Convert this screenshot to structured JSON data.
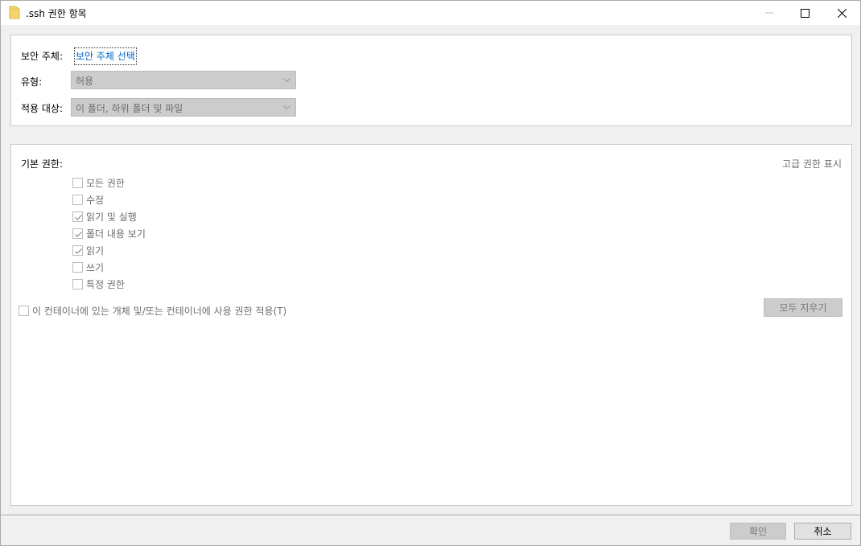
{
  "window": {
    "title": ".ssh 권한 항목"
  },
  "principal": {
    "label": "보안 주체:",
    "link": "보안 주체 선택"
  },
  "type": {
    "label": "유형:",
    "value": "허용"
  },
  "applies_to": {
    "label": "적용 대상:",
    "value": "이 폴더, 하위 폴더 및 파일"
  },
  "basic_permissions": {
    "label": "기본 권한:",
    "advanced_link": "고급 권한 표시",
    "items": [
      {
        "label": "모든 권한",
        "checked": false
      },
      {
        "label": "수정",
        "checked": false
      },
      {
        "label": "읽기 및 실행",
        "checked": true
      },
      {
        "label": "폴더 내용 보기",
        "checked": true
      },
      {
        "label": "읽기",
        "checked": true
      },
      {
        "label": "쓰기",
        "checked": false
      },
      {
        "label": "특정 권한",
        "checked": false
      }
    ],
    "apply_to_container": {
      "label": "이 컨테이너에 있는 개체 및/또는 컨테이너에 사용 권한 적용(T)",
      "checked": false
    },
    "clear_all_button": "모두 지우기"
  },
  "footer": {
    "ok_button": "확인",
    "cancel_button": "취소"
  },
  "colors": {
    "link": "#0066cc",
    "disabled_text": "#6d6d6d",
    "disabled_fill": "#cccccc"
  }
}
